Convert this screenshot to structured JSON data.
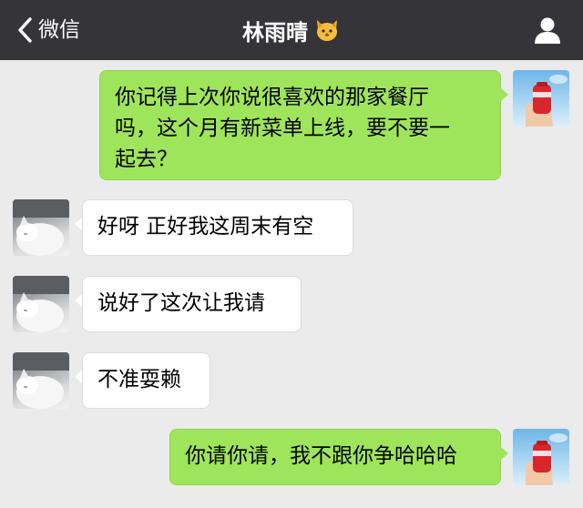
{
  "header": {
    "back_label": "微信",
    "contact_name": "林雨晴",
    "title_icon": "cat-face-icon",
    "profile_icon": "person-icon",
    "bg_color": "#353539"
  },
  "messages": [
    {
      "side": "sent",
      "avatar": "me-avatar",
      "text": "你记得上次你说很喜欢的那家餐厅\n吗，这个月有新菜单上线，要不要一\n起去？"
    },
    {
      "side": "received",
      "avatar": "contact-avatar",
      "text": "好呀 正好我这周末有空"
    },
    {
      "side": "received",
      "avatar": "contact-avatar",
      "text": "说好了这次让我请"
    },
    {
      "side": "received",
      "avatar": "contact-avatar",
      "text": "不准耍赖"
    },
    {
      "side": "sent",
      "avatar": "me-avatar",
      "text": "你请你请，我不跟你争哈哈哈"
    }
  ],
  "colors": {
    "chat_bg": "#ebebeb",
    "sent_bubble": "#9fe55b",
    "received_bubble": "#ffffff"
  }
}
